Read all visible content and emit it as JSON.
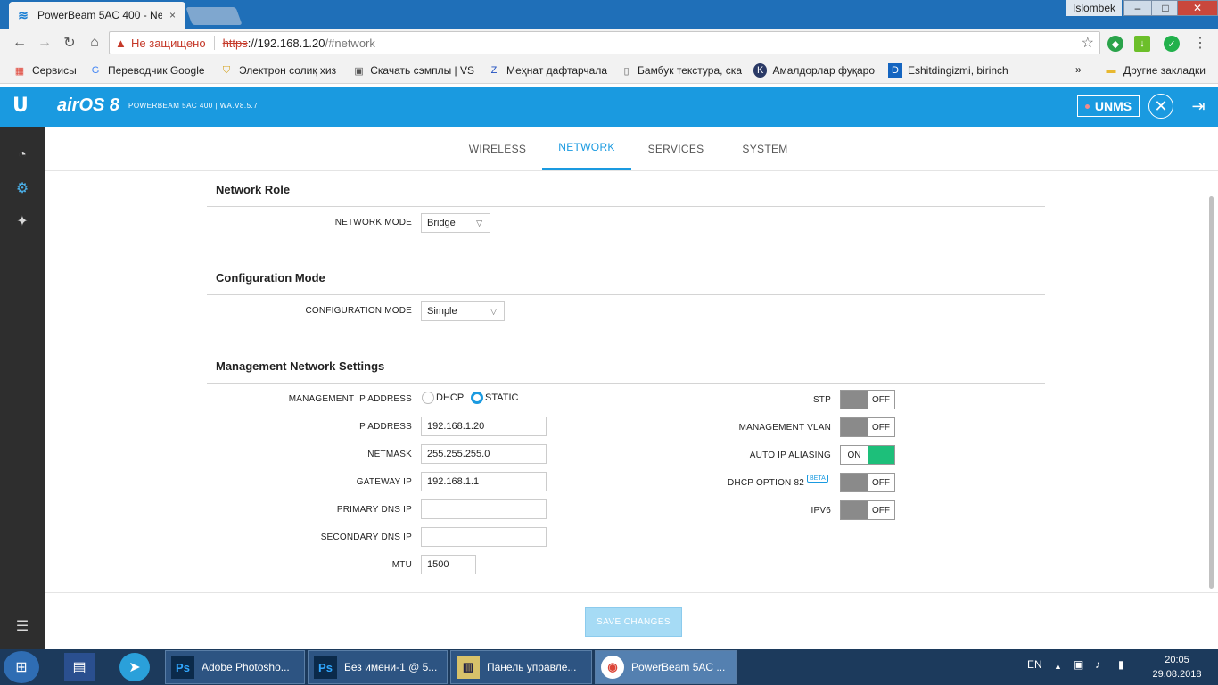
{
  "browser": {
    "tab_title": "PowerBeam 5AC 400 - Ne",
    "tab_close": "×",
    "user_name": "Islombek",
    "win_min": "–",
    "win_max": "□",
    "win_close": "✕",
    "security_text": "Не защищено",
    "url_scheme": "https",
    "url_host": "://192.168.1.20",
    "url_path": "/#network",
    "bookmarks": [
      "Сервисы",
      "Переводчик Google",
      "Электрон солиқ хиз",
      "Скачать сэмплы | VS",
      "Меҳнат дафтарчала",
      "Бамбук текстура, ска",
      "Амалдорлар фуқаро",
      "Eshitdingizmi, birinch"
    ],
    "bookmarks_more": "»",
    "other_bookmarks": "Другие закладки"
  },
  "airos": {
    "logo": "U",
    "product": "airOS 8",
    "device_info": "POWERBEAM 5AC 400 | WA.V8.5.7",
    "unms_label": "UNMS"
  },
  "nav_tabs": [
    "WIRELESS",
    "NETWORK",
    "SERVICES",
    "SYSTEM"
  ],
  "network_role": {
    "title": "Network Role",
    "mode_label": "NETWORK MODE",
    "mode_value": "Bridge"
  },
  "config_mode": {
    "title": "Configuration Mode",
    "mode_label": "CONFIGURATION MODE",
    "mode_value": "Simple"
  },
  "mgmt": {
    "title": "Management Network Settings",
    "ip_mode_label": "MANAGEMENT IP ADDRESS",
    "dhcp_label": "DHCP",
    "static_label": "STATIC",
    "ip_label": "IP ADDRESS",
    "ip_value": "192.168.1.20",
    "netmask_label": "NETMASK",
    "netmask_value": "255.255.255.0",
    "gateway_label": "GATEWAY IP",
    "gateway_value": "192.168.1.1",
    "dns1_label": "PRIMARY DNS IP",
    "dns1_value": "",
    "dns2_label": "SECONDARY DNS IP",
    "dns2_value": "",
    "mtu_label": "MTU",
    "mtu_value": "1500",
    "stp_label": "STP",
    "stp_state": "OFF",
    "vlan_label": "MANAGEMENT VLAN",
    "vlan_state": "OFF",
    "aliasing_label": "AUTO IP ALIASING",
    "aliasing_state": "ON",
    "dhcp82_label": "DHCP OPTION 82",
    "beta_badge": "BETA",
    "dhcp82_state": "OFF",
    "ipv6_label": "IPV6",
    "ipv6_state": "OFF"
  },
  "save_button": "SAVE CHANGES",
  "taskbar": {
    "items": [
      "Adobe Photosho...",
      "Без имени-1 @ 5...",
      "Панель управле...",
      "PowerBeam 5AC ..."
    ],
    "lang": "EN",
    "time": "20:05",
    "date": "29.08.2018"
  },
  "colors": {
    "accent": "#1a9ae0",
    "toggle_on": "#1dbf7a",
    "sidebar": "#2e2e2e"
  }
}
